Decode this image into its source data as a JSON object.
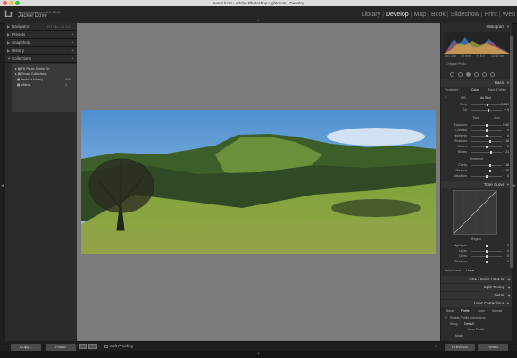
{
  "window": {
    "title": "aws-2.lrcat - Adobe Photoshop Lightroom - Develop",
    "traffic_colors": [
      "#fc5f57",
      "#fdbc2e",
      "#28c840"
    ]
  },
  "identity": {
    "logo": "Lr",
    "subtitle": "Adobe Lightroom CC 2015",
    "user": "Jackie Dove"
  },
  "modules": [
    "Library",
    "Develop",
    "Map",
    "Book",
    "Slideshow",
    "Print",
    "Web"
  ],
  "active_module": "Develop",
  "left_panel": {
    "navigator": {
      "label": "Navigator",
      "extra": "FIT  FILL  1:1  1:4"
    },
    "presets": "Presets",
    "snapshots": "Snapshots",
    "history": "History",
    "collections": "Collections",
    "collection_items": [
      {
        "label": "Fit Photo Studio CK",
        "count": ""
      },
      {
        "label": "Smart Collections",
        "count": ""
      },
      {
        "label": "Jackie's Library",
        "count": "911"
      },
      {
        "label": "Videos",
        "count": "1"
      }
    ],
    "copy_button": "Copy...",
    "paste_button": "Paste"
  },
  "toolbar": {
    "soft_proofing": "Soft Proofing"
  },
  "right_panel": {
    "histogram": "Histogram",
    "histogram_info": [
      "ISO 200",
      "35 mm",
      "f / 8.0",
      "1/250 sec"
    ],
    "original_photo": "Original Photo",
    "basic": "Basic",
    "treatment": "Treatment :",
    "color_label": "Color",
    "bw_label": "Black & White",
    "wb_label": "WB :",
    "wb_value": "As Shot",
    "temp_label": "Temp",
    "temp_value": "5,450",
    "tint_label": "Tint",
    "tint_value": "+ 5",
    "tone": "Tone",
    "auto": "Auto",
    "tone_sliders": [
      {
        "label": "Exposure",
        "value": "0.00",
        "pos": 0.5
      },
      {
        "label": "Contrast",
        "value": "0",
        "pos": 0.5
      },
      {
        "label": "Highlights",
        "value": "0",
        "pos": 0.5
      },
      {
        "label": "Shadows",
        "value": "+ 18",
        "pos": 0.62
      },
      {
        "label": "Whites",
        "value": "0",
        "pos": 0.5
      },
      {
        "label": "Blacks",
        "value": "+ 21",
        "pos": 0.64
      }
    ],
    "presence": "Presence",
    "presence_sliders": [
      {
        "label": "Clarity",
        "value": "+ 18",
        "pos": 0.62
      },
      {
        "label": "Vibrance",
        "value": "+ 18",
        "pos": 0.62
      },
      {
        "label": "Saturation",
        "value": "0",
        "pos": 0.5
      }
    ],
    "tone_curve": "Tone Curve",
    "region": "Region",
    "region_sliders": [
      {
        "label": "Highlights",
        "value": "0",
        "pos": 0.5
      },
      {
        "label": "Lights",
        "value": "0",
        "pos": 0.5
      },
      {
        "label": "Darks",
        "value": "0",
        "pos": 0.5
      },
      {
        "label": "Shadows",
        "value": "0",
        "pos": 0.5
      }
    ],
    "point_curve_label": "Point Curve :",
    "point_curve_value": "Linear",
    "hsl": "HSL / Color / B & W",
    "split_toning": "Split Toning",
    "detail": "Detail",
    "lens_corrections": "Lens Corrections",
    "lens_tabs": [
      "Basic",
      "Profile",
      "Color",
      "Manual"
    ],
    "enable_profile": "Enable Profile Corrections",
    "setup_label": "Setup :",
    "setup_value": "Default",
    "lens_profile": "Lens Profile",
    "make_label": "Make",
    "previous_button": "Previous",
    "reset_button": "Reset"
  }
}
